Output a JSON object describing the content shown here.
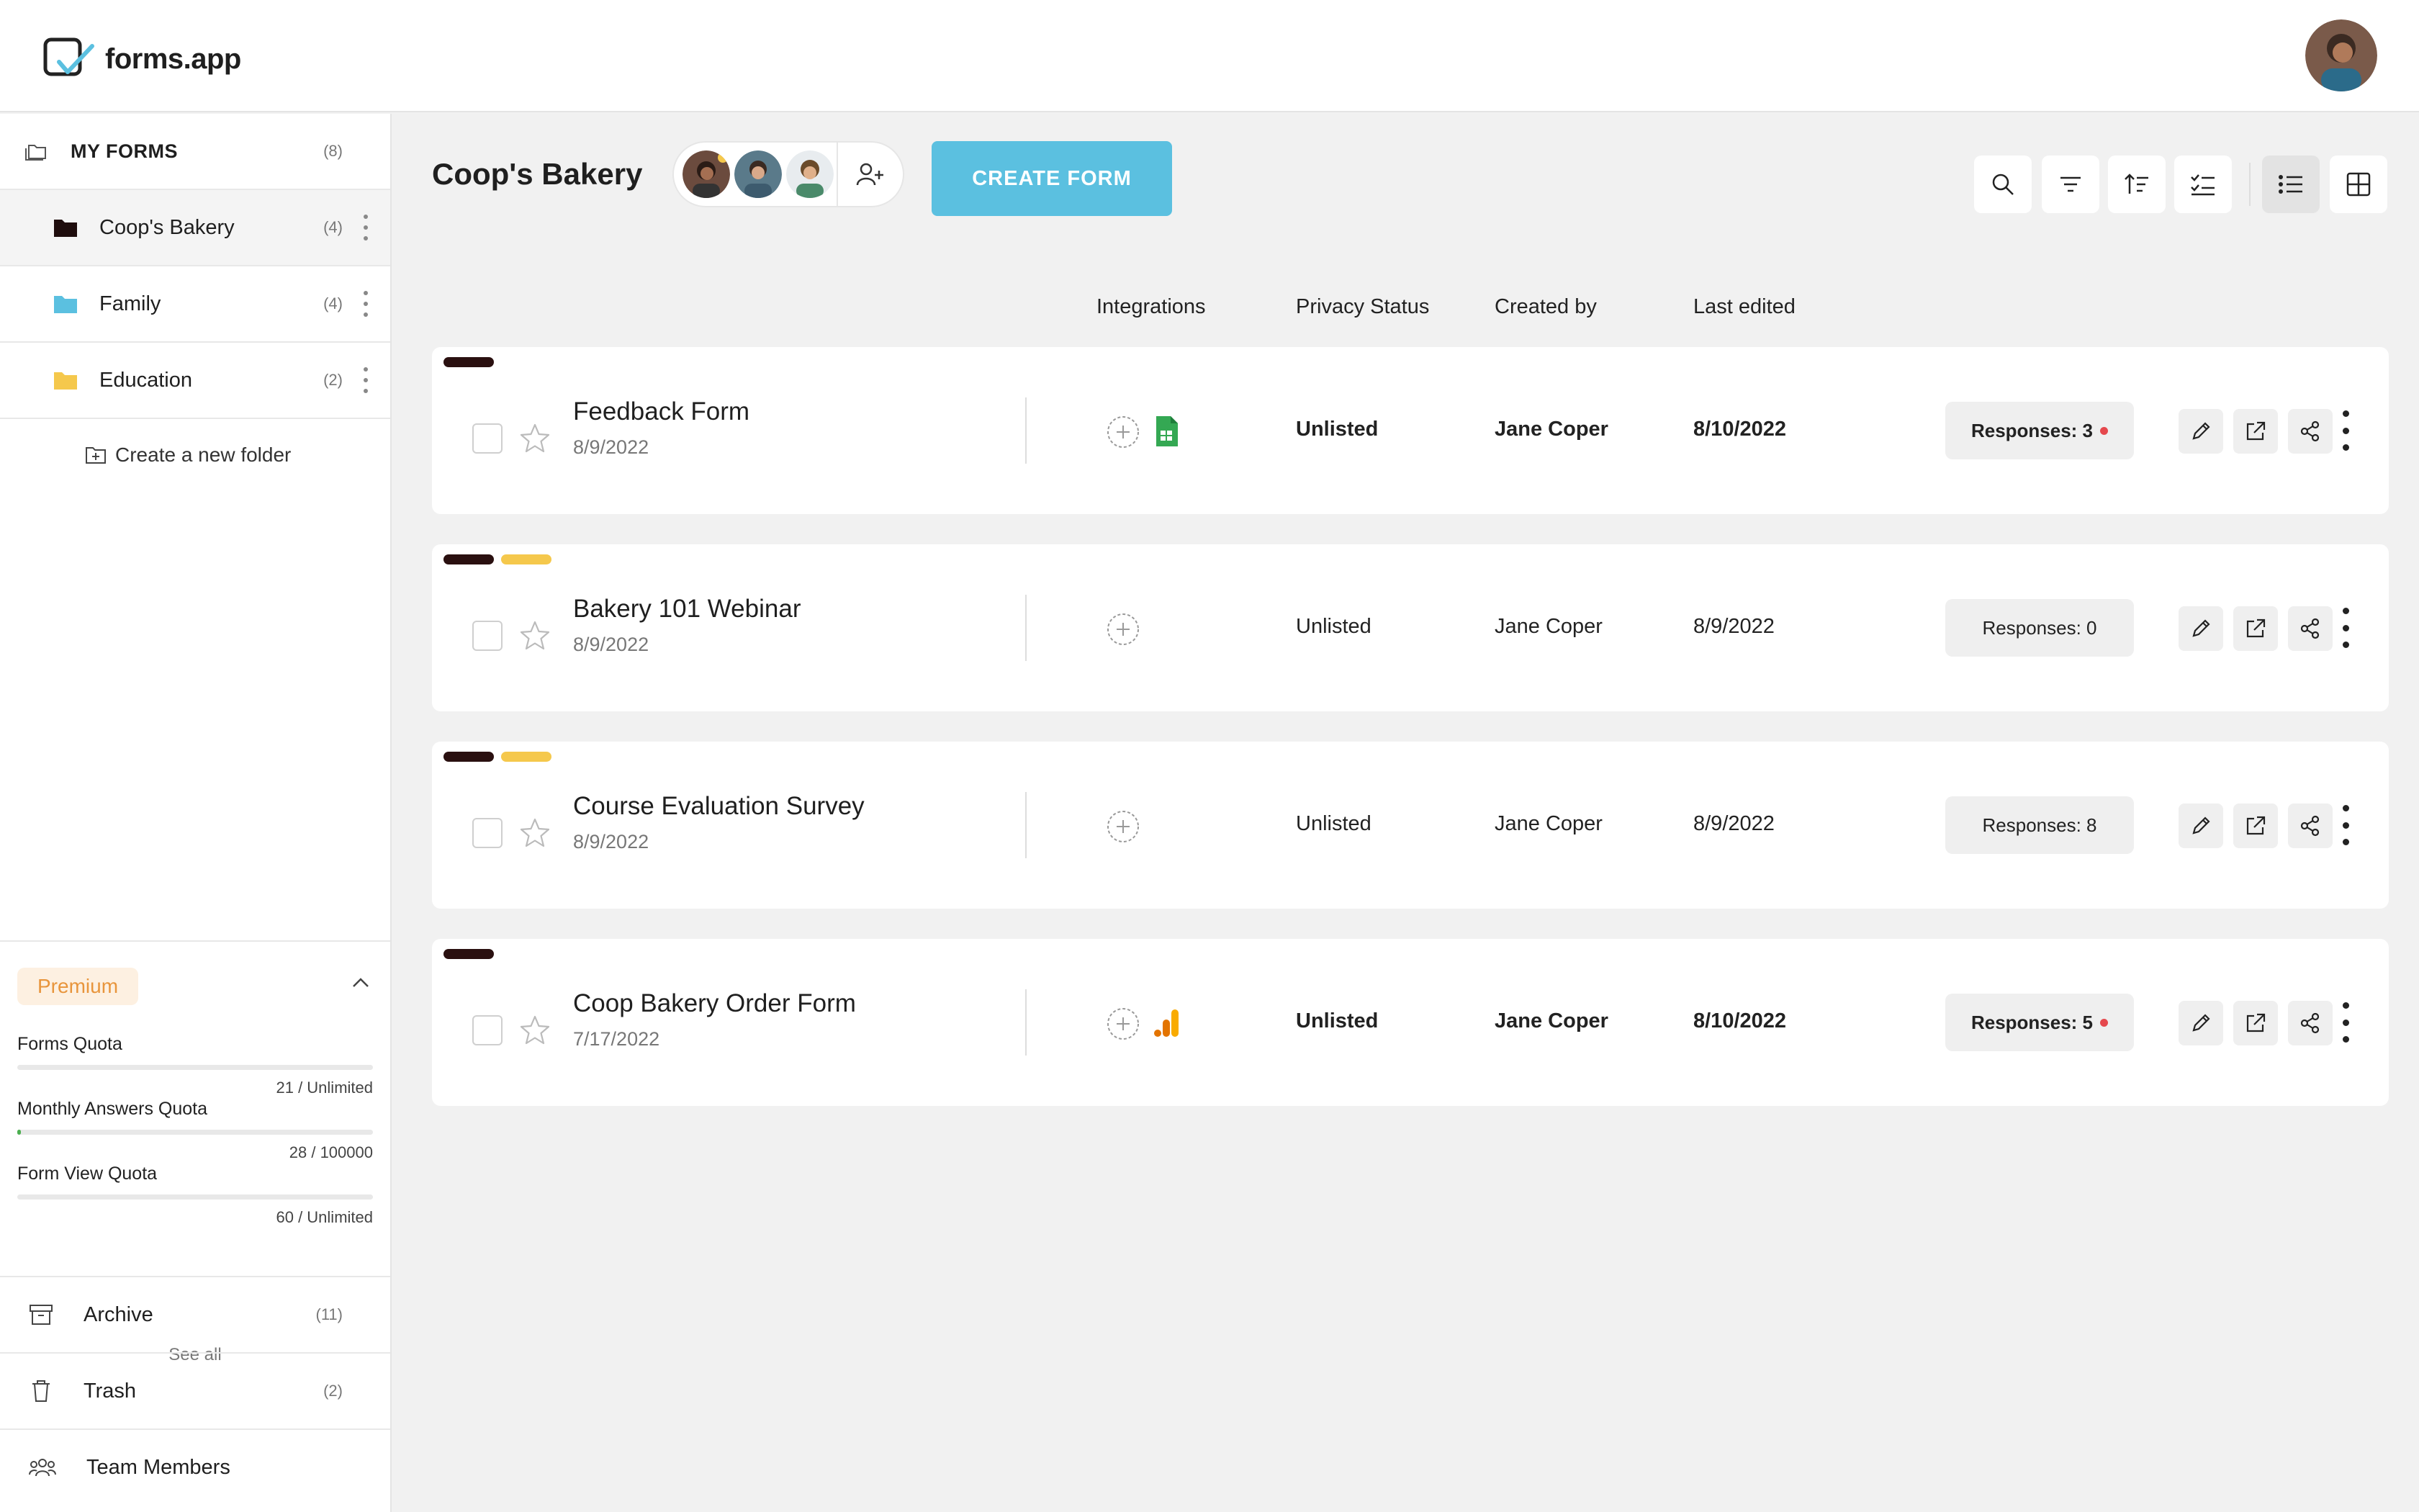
{
  "app": {
    "logo_text": "forms.app"
  },
  "sidebar": {
    "my_forms": {
      "label": "MY FORMS",
      "count": "(8)"
    },
    "folders": [
      {
        "label": "Coop's Bakery",
        "count": "(4)",
        "color": "#1f0d0d"
      },
      {
        "label": "Family",
        "count": "(4)",
        "color": "#5bc0e0"
      },
      {
        "label": "Education",
        "count": "(2)",
        "color": "#f5c84c"
      }
    ],
    "new_folder_label": "Create a new folder",
    "premium": {
      "badge": "Premium",
      "quotas": [
        {
          "title": "Forms Quota",
          "value": "21 / Unlimited",
          "fraction": 0
        },
        {
          "title": "Monthly Answers Quota",
          "value": "28 / 100000",
          "fraction": 0.0003
        },
        {
          "title": "Form View Quota",
          "value": "60 / Unlimited",
          "fraction": 0
        }
      ],
      "see_all": "See all"
    },
    "bottom": [
      {
        "label": "Archive",
        "count": "(11)",
        "icon": "archive-icon"
      },
      {
        "label": "Trash",
        "count": "(2)",
        "icon": "trash-icon"
      },
      {
        "label": "Team Members",
        "count": "",
        "icon": "team-icon"
      }
    ]
  },
  "main": {
    "title": "Coop's Bakery",
    "create_button": "CREATE FORM",
    "columns": {
      "integrations": "Integrations",
      "privacy": "Privacy Status",
      "created_by": "Created by",
      "last_edited": "Last edited"
    },
    "forms": [
      {
        "name": "Feedback Form",
        "date": "8/9/2022",
        "privacy": "Unlisted",
        "created_by": "Jane Coper",
        "last_edited": "8/10/2022",
        "responses": "Responses: 3",
        "unread": true,
        "tags": [
          "#2a1010"
        ],
        "integration": "google-sheets-icon"
      },
      {
        "name": "Bakery 101 Webinar",
        "date": "8/9/2022",
        "privacy": "Unlisted",
        "created_by": "Jane Coper",
        "last_edited": "8/9/2022",
        "responses": "Responses: 0",
        "unread": false,
        "tags": [
          "#2a1010",
          "#f5c84c"
        ],
        "integration": ""
      },
      {
        "name": "Course Evaluation Survey",
        "date": "8/9/2022",
        "privacy": "Unlisted",
        "created_by": "Jane Coper",
        "last_edited": "8/9/2022",
        "responses": "Responses: 8",
        "unread": false,
        "tags": [
          "#2a1010",
          "#f5c84c"
        ],
        "integration": ""
      },
      {
        "name": "Coop Bakery Order Form",
        "date": "7/17/2022",
        "privacy": "Unlisted",
        "created_by": "Jane Coper",
        "last_edited": "8/10/2022",
        "responses": "Responses: 5",
        "unread": true,
        "tags": [
          "#2a1010"
        ],
        "integration": "google-analytics-icon"
      }
    ]
  },
  "colors": {
    "accent": "#5bc0e0",
    "folder_dark": "#1f0d0d",
    "unread_dot": "#e5484d",
    "premium_text": "#e8953c"
  }
}
